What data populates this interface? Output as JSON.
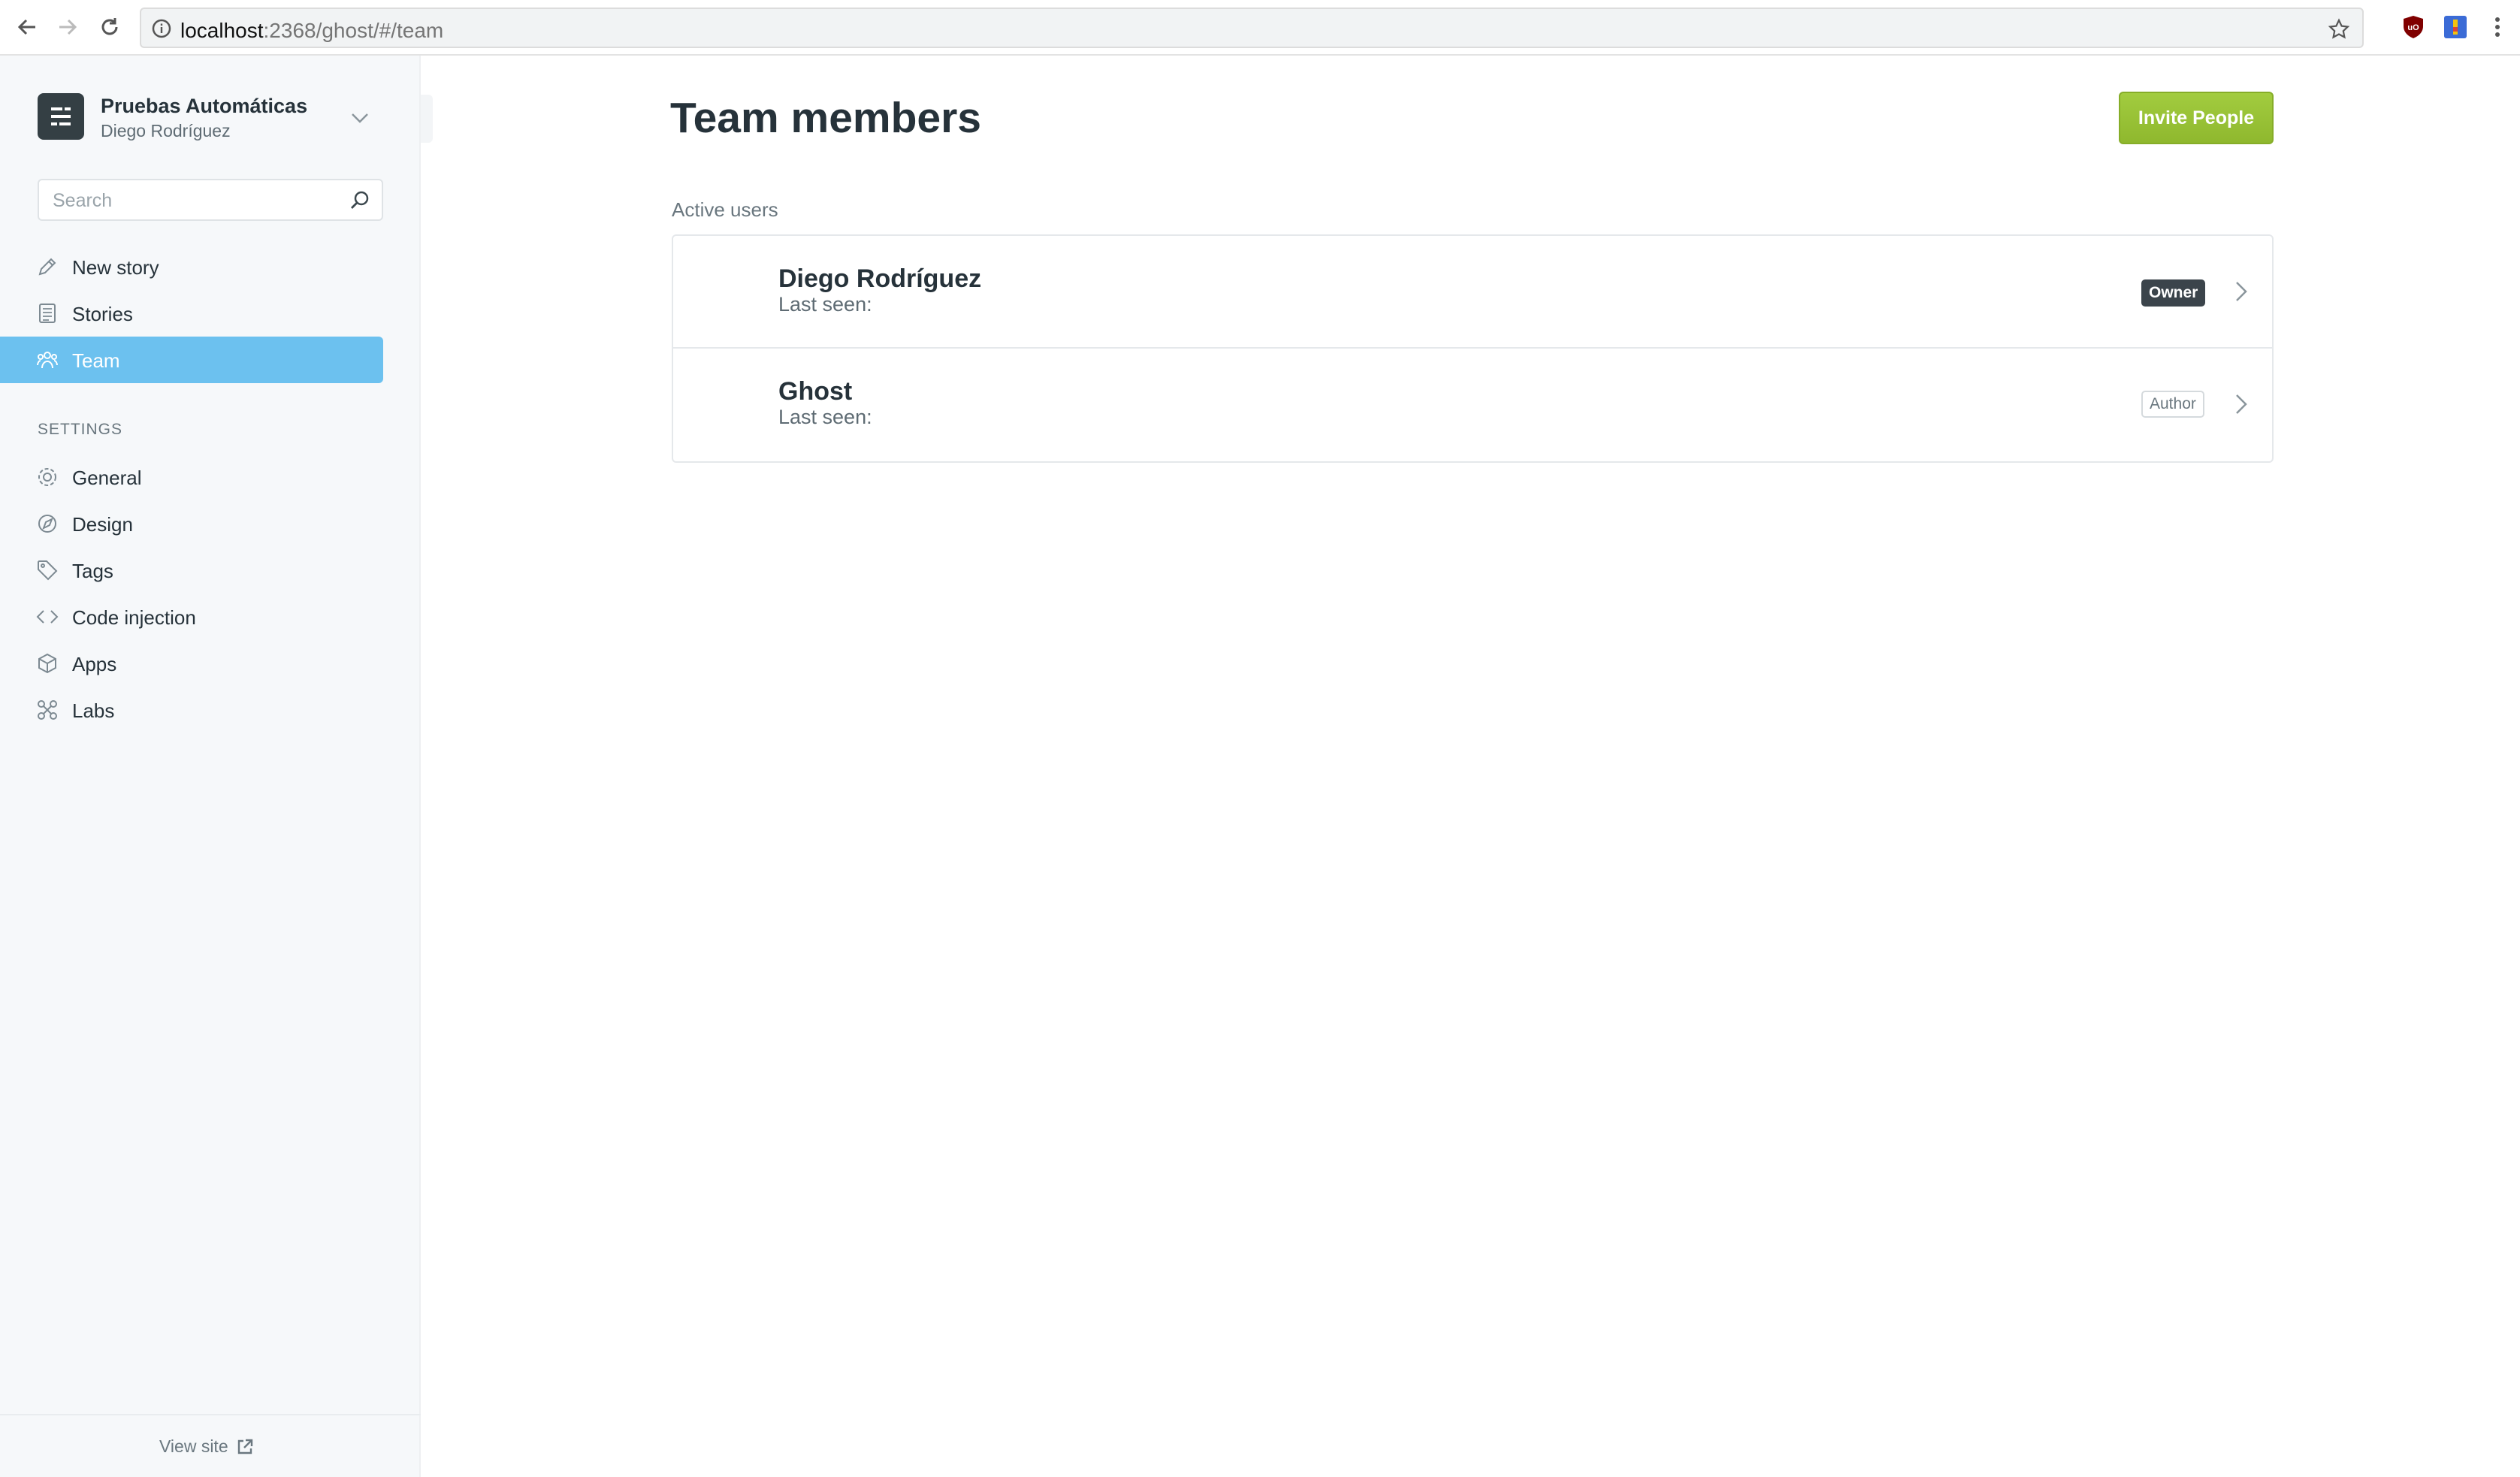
{
  "browser": {
    "url_host": "localhost",
    "url_rest": ":2368/ghost/#/team"
  },
  "sidebar": {
    "brand_title": "Pruebas Automáticas",
    "brand_user": "Diego Rodríguez",
    "search_placeholder": "Search",
    "main_items": [
      {
        "label": "New story",
        "icon": "pencil-icon"
      },
      {
        "label": "Stories",
        "icon": "stories-icon"
      },
      {
        "label": "Team",
        "icon": "team-icon",
        "active": true
      }
    ],
    "settings_heading": "SETTINGS",
    "settings_items": [
      {
        "label": "General",
        "icon": "gear-icon"
      },
      {
        "label": "Design",
        "icon": "design-icon"
      },
      {
        "label": "Tags",
        "icon": "tag-icon"
      },
      {
        "label": "Code injection",
        "icon": "code-icon"
      },
      {
        "label": "Apps",
        "icon": "apps-icon"
      },
      {
        "label": "Labs",
        "icon": "labs-icon"
      }
    ],
    "view_site": "View site"
  },
  "main": {
    "title": "Team members",
    "invite_button": "Invite People",
    "section_label": "Active users",
    "users": [
      {
        "name": "Diego Rodríguez",
        "last_seen": "Last seen:",
        "role": "Owner"
      },
      {
        "name": "Ghost",
        "last_seen": "Last seen:",
        "role": "Author"
      }
    ]
  },
  "colors": {
    "accent_active": "#6cc1ef",
    "invite_green": "#9bc53d",
    "owner_badge": "#3b444b"
  }
}
